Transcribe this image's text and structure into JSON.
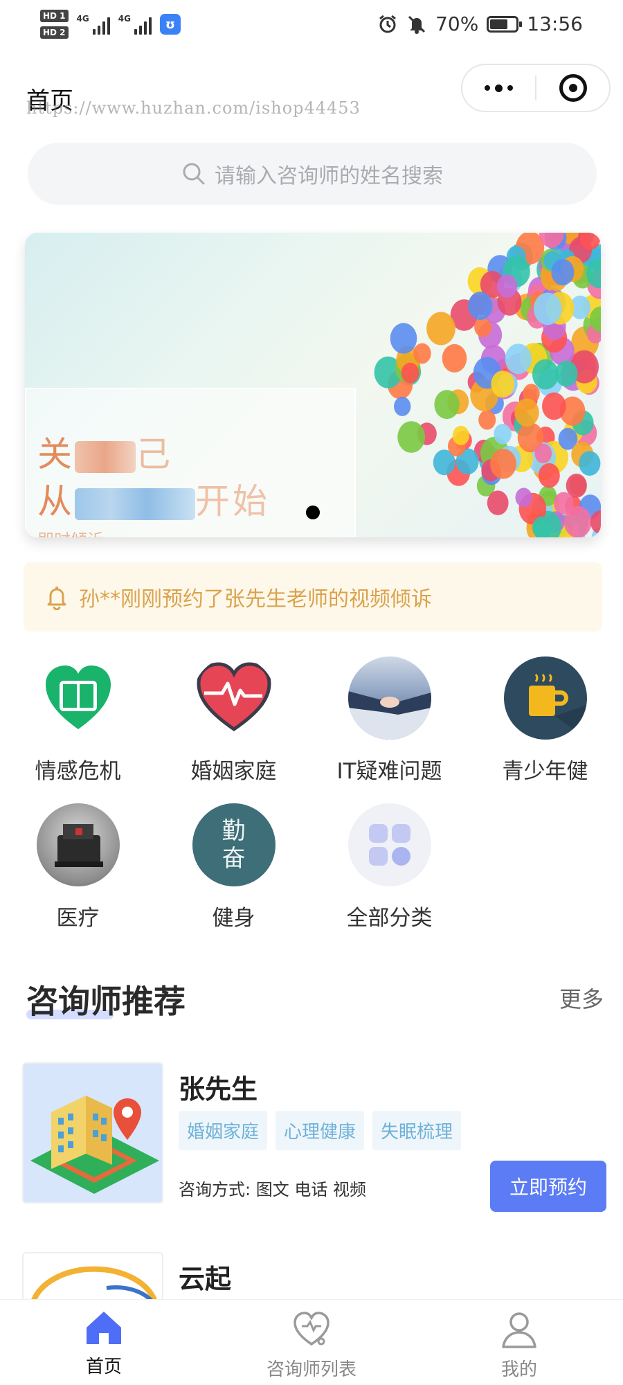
{
  "status_bar": {
    "hd1": "HD 1",
    "hd2": "HD 2",
    "net1": "4G",
    "net2": "4G",
    "battery_pct": "70%",
    "battery_level": 0.7,
    "time": "13:56",
    "icons": [
      "alarm-icon",
      "mute-icon",
      "battery-icon"
    ]
  },
  "header": {
    "title": "首页",
    "watermark": "https://www.huzhan.com/ishop44453"
  },
  "search": {
    "placeholder": "请输入咨询师的姓名搜索"
  },
  "banner": {
    "line1_visible": "关",
    "line1_tail": "己",
    "line2_visible": "从",
    "line2_tail": "开始",
    "line3": "即时倾诉",
    "active_page": 1
  },
  "notice": {
    "text": "孙**刚刚预约了张先生老师的视频倾诉"
  },
  "categories": [
    {
      "label": "情感危机"
    },
    {
      "label": "婚姻家庭"
    },
    {
      "label": "IT疑难问题"
    },
    {
      "label": "青少年健"
    },
    {
      "label": "医疗"
    },
    {
      "label": "健身"
    },
    {
      "label": "全部分类"
    }
  ],
  "fitness_icon_text": [
    "勤",
    "奋"
  ],
  "section": {
    "title": "咨询师推荐",
    "more": "更多"
  },
  "counselors": [
    {
      "name": "张先生",
      "tags": [
        "婚姻家庭",
        "心理健康",
        "失眠梳理"
      ],
      "ways_label": "咨询方式:",
      "ways": "图文 电话 视频",
      "book_label": "立即预约"
    },
    {
      "name": "云起"
    }
  ],
  "tabbar": [
    {
      "label": "首页",
      "active": true
    },
    {
      "label": "咨询师列表",
      "active": false
    },
    {
      "label": "我的",
      "active": false
    }
  ],
  "colors": {
    "accent": "#5b7cf5",
    "tag_bg": "#eef6fb",
    "tag_text": "#6fb1d8",
    "notice_bg": "#fdf8ea",
    "notice_text": "#dba24d",
    "tab_active": "#4f6ef7"
  }
}
